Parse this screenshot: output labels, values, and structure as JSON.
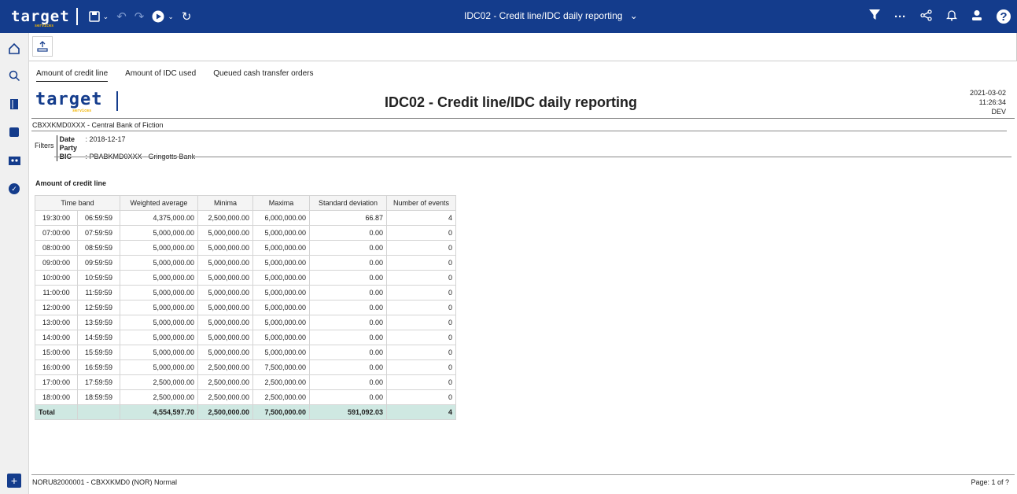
{
  "topbar": {
    "brand": "target",
    "brand_sub": "services",
    "title": "IDC02 - Credit line/IDC daily reporting",
    "accent": "#143c8c",
    "brand_accent": "#f2b400"
  },
  "icons": {
    "save": "floppy-disk-icon",
    "undo": "undo-icon",
    "redo": "redo-icon",
    "run": "play-icon",
    "refresh": "refresh-icon",
    "filter": "filter-icon",
    "more": "ellipsis-icon",
    "share": "share-icon",
    "notifications": "bell-icon",
    "user": "user-icon",
    "help": "help-icon"
  },
  "tabs": [
    "Amount of credit line",
    "Amount of IDC used",
    "Queued cash transfer orders"
  ],
  "report": {
    "logo": "target",
    "logo_sub": "services",
    "title": "IDC02 - Credit line/IDC daily reporting",
    "date": "2021-03-02",
    "time": "11:26:34",
    "env": "DEV",
    "bank": "CBXXKMD0XXX - Central Bank of Fiction",
    "filters_label": "Filters",
    "filter_date_label": "Date",
    "filter_date_value": ": 2018-12-17",
    "filter_party_label": "Party BIC",
    "filter_party_value": ": PBABKMD0XXX - Gringotts Bank",
    "section_title": "Amount of credit line"
  },
  "table": {
    "headers": [
      "Time band",
      "Weighted average",
      "Minima",
      "Maxima",
      "Standard deviation",
      "Number of events"
    ],
    "rows": [
      [
        "19:30:00",
        "06:59:59",
        "4,375,000.00",
        "2,500,000.00",
        "6,000,000.00",
        "66.87",
        "4"
      ],
      [
        "07:00:00",
        "07:59:59",
        "5,000,000.00",
        "5,000,000.00",
        "5,000,000.00",
        "0.00",
        "0"
      ],
      [
        "08:00:00",
        "08:59:59",
        "5,000,000.00",
        "5,000,000.00",
        "5,000,000.00",
        "0.00",
        "0"
      ],
      [
        "09:00:00",
        "09:59:59",
        "5,000,000.00",
        "5,000,000.00",
        "5,000,000.00",
        "0.00",
        "0"
      ],
      [
        "10:00:00",
        "10:59:59",
        "5,000,000.00",
        "5,000,000.00",
        "5,000,000.00",
        "0.00",
        "0"
      ],
      [
        "11:00:00",
        "11:59:59",
        "5,000,000.00",
        "5,000,000.00",
        "5,000,000.00",
        "0.00",
        "0"
      ],
      [
        "12:00:00",
        "12:59:59",
        "5,000,000.00",
        "5,000,000.00",
        "5,000,000.00",
        "0.00",
        "0"
      ],
      [
        "13:00:00",
        "13:59:59",
        "5,000,000.00",
        "5,000,000.00",
        "5,000,000.00",
        "0.00",
        "0"
      ],
      [
        "14:00:00",
        "14:59:59",
        "5,000,000.00",
        "5,000,000.00",
        "5,000,000.00",
        "0.00",
        "0"
      ],
      [
        "15:00:00",
        "15:59:59",
        "5,000,000.00",
        "5,000,000.00",
        "5,000,000.00",
        "0.00",
        "0"
      ],
      [
        "16:00:00",
        "16:59:59",
        "5,000,000.00",
        "2,500,000.00",
        "7,500,000.00",
        "0.00",
        "0"
      ],
      [
        "17:00:00",
        "17:59:59",
        "2,500,000.00",
        "2,500,000.00",
        "2,500,000.00",
        "0.00",
        "0"
      ],
      [
        "18:00:00",
        "18:59:59",
        "2,500,000.00",
        "2,500,000.00",
        "2,500,000.00",
        "0.00",
        "0"
      ]
    ],
    "total": [
      "Total",
      "",
      "4,554,597.70",
      "2,500,000.00",
      "7,500,000.00",
      "591,092.03",
      "4"
    ],
    "total_color": "#cfe8e2"
  },
  "footer": {
    "left": "NORU82000001 - CBXXKMD0 (NOR) Normal",
    "right": "Page: 1 of ?"
  }
}
